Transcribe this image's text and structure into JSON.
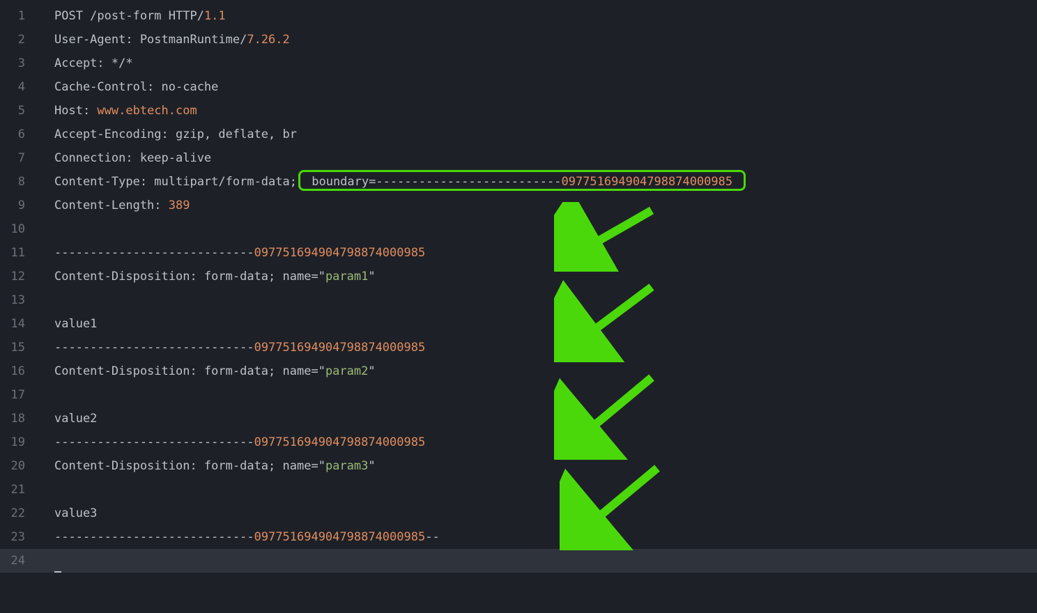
{
  "colors": {
    "background": "#1d2127",
    "gutter": "#6b717b",
    "default": "#bcc1c9",
    "orange": "#e28c5f",
    "green": "#9cba77",
    "highlight": "#4ad80a",
    "activeLine": "#2e333c"
  },
  "lineNumbers": [
    "1",
    "2",
    "3",
    "4",
    "5",
    "6",
    "7",
    "8",
    "9",
    "10",
    "11",
    "12",
    "13",
    "14",
    "15",
    "16",
    "17",
    "18",
    "19",
    "20",
    "21",
    "22",
    "23",
    "24"
  ],
  "code": {
    "l1": {
      "a": "POST /post-form HTTP/",
      "b": "1.1"
    },
    "l2": {
      "a": "User-Agent: PostmanRuntime/",
      "b": "7.26.2"
    },
    "l3": {
      "a": "Accept: */*"
    },
    "l4": {
      "a": "Cache-Control: no-cache"
    },
    "l5": {
      "a": "Host: ",
      "b": "www.ebtech.com"
    },
    "l6": {
      "a": "Accept-Encoding: gzip, deflate, br"
    },
    "l7": {
      "a": "Connection: keep-alive"
    },
    "l8": {
      "a": "Content-Type: multipart/form-data;",
      "b": " boundary=--------------------------",
      "c": "097751694904798874000985 "
    },
    "l9": {
      "a": "Content-Length: ",
      "b": "389"
    },
    "l11": {
      "a": "----------------------------",
      "b": "097751694904798874000985"
    },
    "l12": {
      "a": "Content-Disposition: form-data; name=\"",
      "b": "param1",
      "c": "\""
    },
    "l14": {
      "a": "value1"
    },
    "l15": {
      "a": "----------------------------",
      "b": "097751694904798874000985"
    },
    "l16": {
      "a": "Content-Disposition: form-data; name=\"",
      "b": "param2",
      "c": "\""
    },
    "l18": {
      "a": "value2"
    },
    "l19": {
      "a": "----------------------------",
      "b": "097751694904798874000985"
    },
    "l20": {
      "a": "Content-Disposition: form-data; name=\"",
      "b": "param3",
      "c": "\""
    },
    "l22": {
      "a": "value3"
    },
    "l23": {
      "a": "----------------------------",
      "b": "097751694904798874000985",
      "c": "--"
    }
  }
}
